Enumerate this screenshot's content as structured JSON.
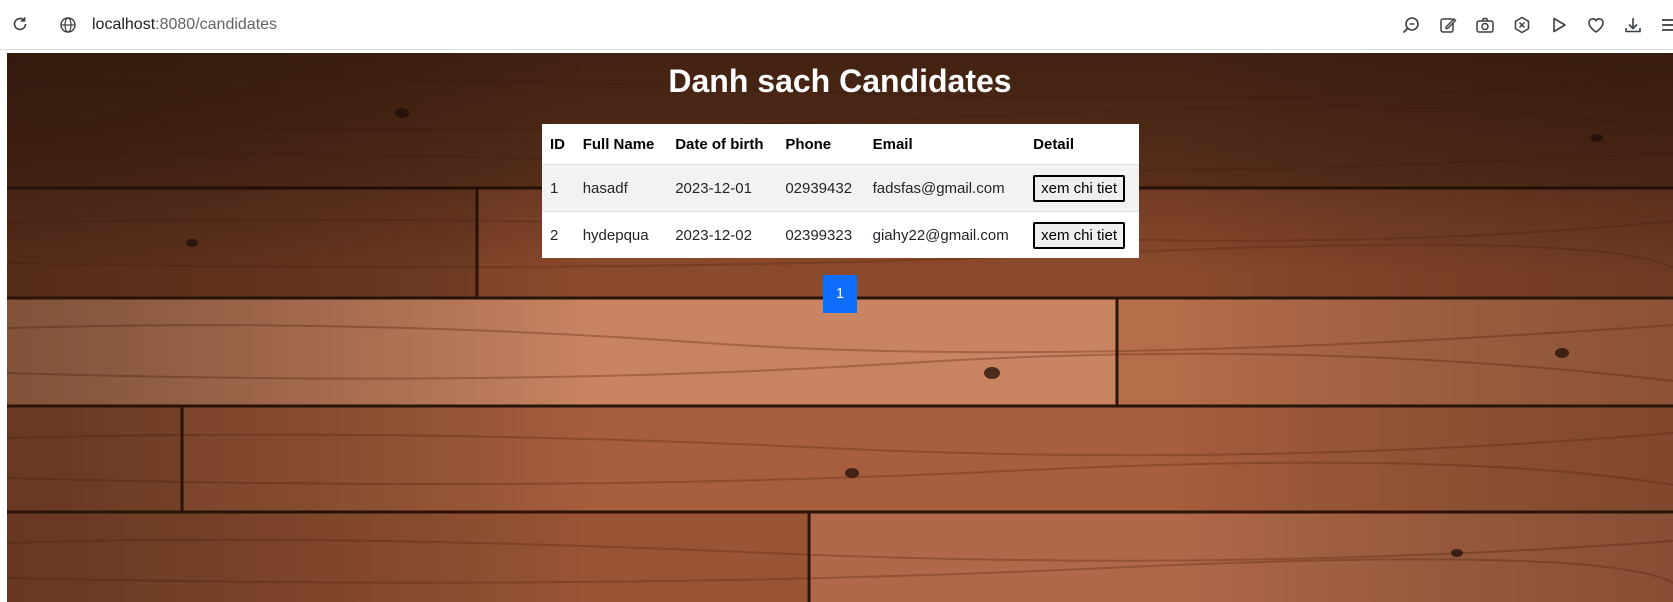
{
  "browser": {
    "url_host": "localhost",
    "url_path": ":8080/candidates",
    "toolbar_icons": [
      "zoom-icon",
      "edit-icon",
      "camera-icon",
      "close-circle-icon",
      "play-icon",
      "heart-icon",
      "download-icon",
      "menu-icon"
    ]
  },
  "page": {
    "title": "Danh sach Candidates"
  },
  "table": {
    "headers": {
      "id": "ID",
      "full_name": "Full Name",
      "dob": "Date of birth",
      "phone": "Phone",
      "email": "Email",
      "detail": "Detail"
    },
    "rows": [
      {
        "id": "1",
        "full_name": "hasadf",
        "dob": "2023-12-01",
        "phone": "02939432",
        "email": "fadsfas@gmail.com",
        "detail_label": "xem chi tiet"
      },
      {
        "id": "2",
        "full_name": "hydepqua",
        "dob": "2023-12-02",
        "phone": "02399323",
        "email": "giahy22@gmail.com",
        "detail_label": "xem chi tiet"
      }
    ]
  },
  "pagination": {
    "pages": [
      "1"
    ],
    "active_page": "1",
    "active_color": "#0d6efd"
  },
  "colors": {
    "title_text": "#ffffff",
    "wood_base": "#8a4a2b"
  }
}
